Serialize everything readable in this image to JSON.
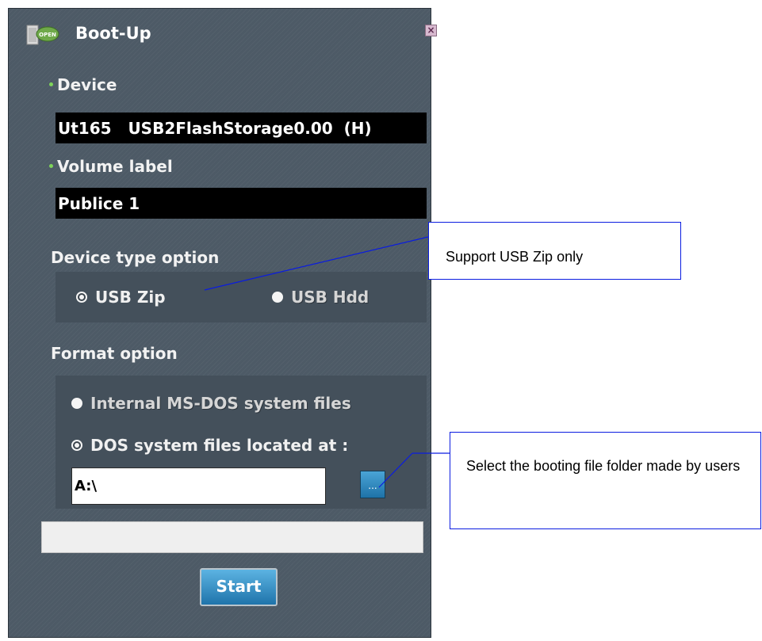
{
  "window": {
    "title": "Boot-Up",
    "icon": "usb-drive-icon",
    "icon_badge": "OPEN",
    "close_label": "×"
  },
  "device": {
    "label": "Device",
    "value": "Ut165   USB2FlashStorage0.00  (H)"
  },
  "volume": {
    "label": "Volume label",
    "value": "Publice 1"
  },
  "device_type": {
    "label": "Device type option",
    "options": [
      {
        "label": "USB Zip",
        "checked": true
      },
      {
        "label": "USB Hdd",
        "checked": false
      }
    ]
  },
  "format": {
    "label": "Format option",
    "options": [
      {
        "label": "Internal MS-DOS system files",
        "checked": false
      },
      {
        "label": "DOS system files located at :",
        "checked": true
      }
    ],
    "path_value": "A:\\",
    "browse_label": "..."
  },
  "progress": {
    "value": 0
  },
  "start_label": "Start",
  "callouts": [
    {
      "text": "Support USB Zip only"
    },
    {
      "text": "Select the booting file folder made by users"
    }
  ],
  "colors": {
    "window_bg": "#4d5a66",
    "panel_bg": "#44505b",
    "accent_blue": "#1f74ab",
    "bullet_green": "#7ed35a",
    "callout_border": "#0a1ce0"
  }
}
